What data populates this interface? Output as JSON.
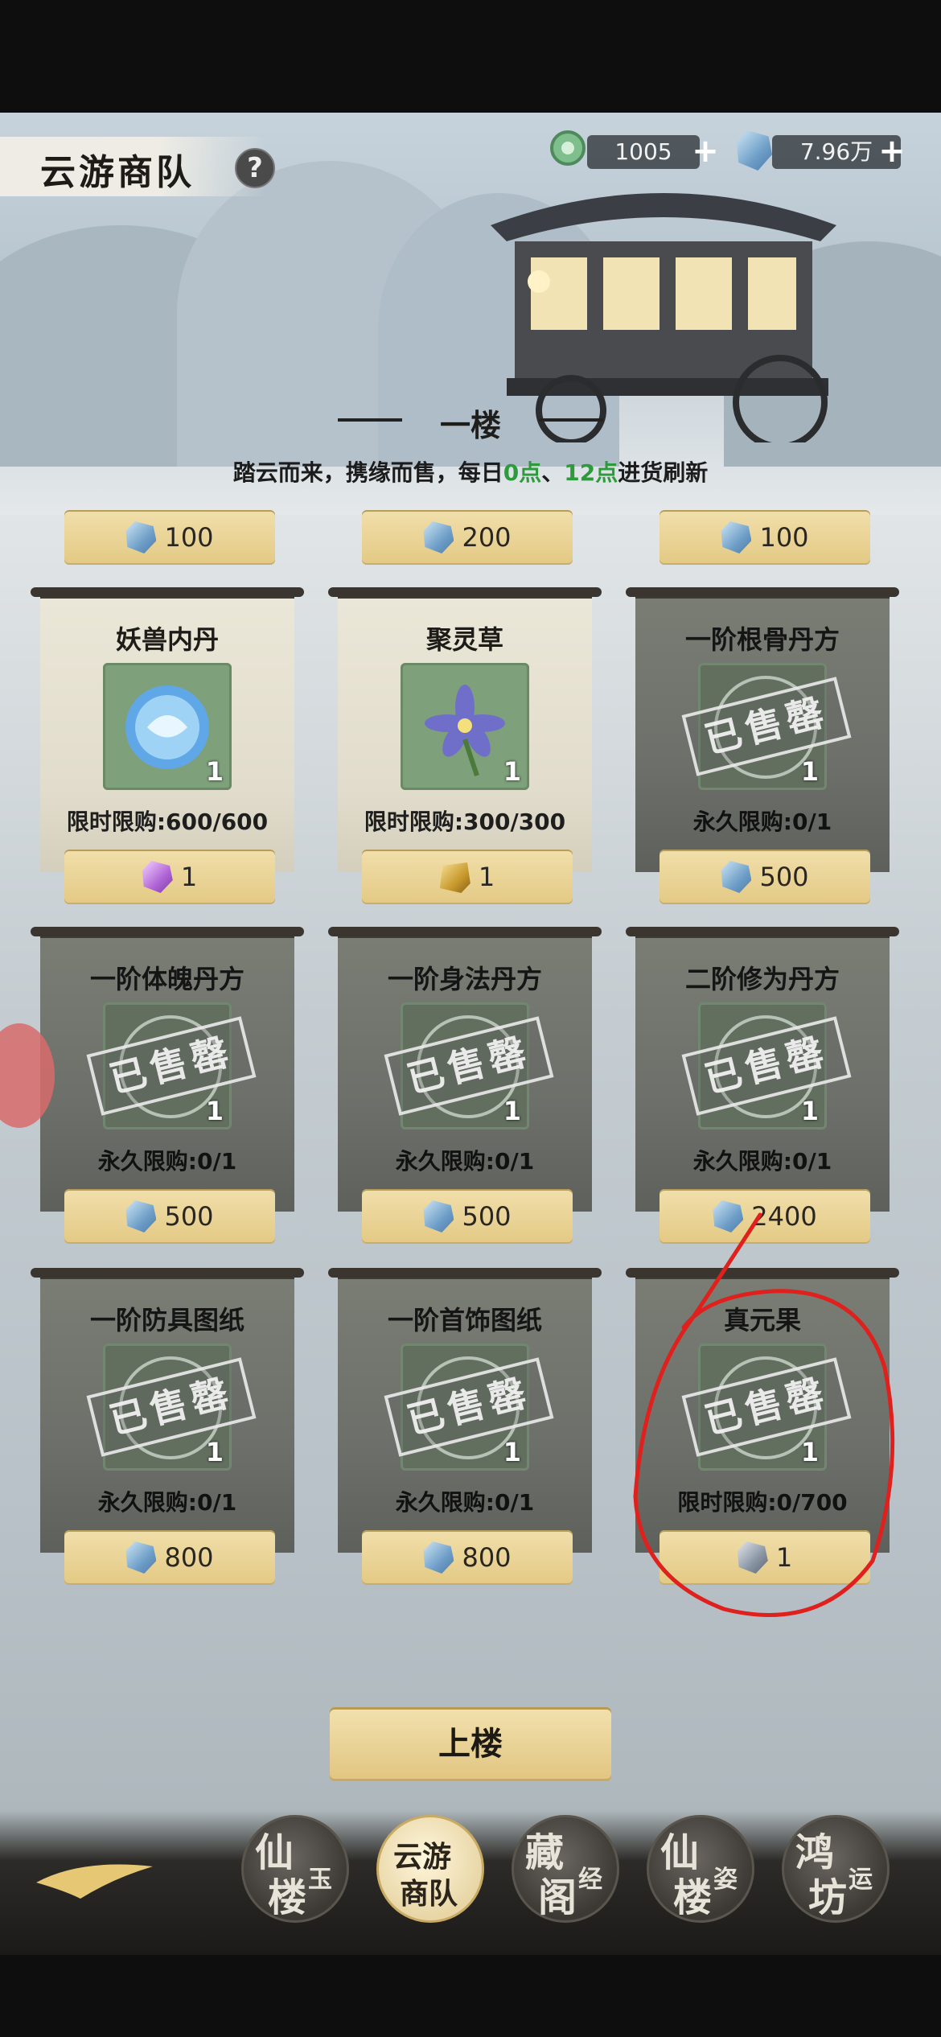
{
  "header": {
    "title": "云游商队",
    "help_label": "?",
    "currency": [
      {
        "icon": "jade-token-icon",
        "value": "1005",
        "plus": "+"
      },
      {
        "icon": "spirit-stone-icon",
        "value": "7.96万",
        "plus": "+"
      }
    ]
  },
  "floor": {
    "title": "一楼",
    "subtitle_pre": "踏云而来，携缘而售，每日",
    "subtitle_t1": "0点",
    "subtitle_sep": "、",
    "subtitle_t2": "12点",
    "subtitle_post": "进货刷新"
  },
  "top_prices": [
    "100",
    "200",
    "100"
  ],
  "cards": [
    {
      "name": "妖兽内丹",
      "count": "1",
      "limit": "限时限购:600/600",
      "price": "1",
      "currency_icon": "purple-crystal-icon",
      "sold_out": false
    },
    {
      "name": "聚灵草",
      "count": "1",
      "limit": "限时限购:300/300",
      "price": "1",
      "currency_icon": "gold-ingot-icon",
      "sold_out": false
    },
    {
      "name": "一阶根骨丹方",
      "count": "1",
      "limit": "永久限购:0/1",
      "price": "500",
      "currency_icon": "spirit-stone-icon",
      "sold_out": true
    },
    {
      "name": "一阶体魄丹方",
      "count": "1",
      "limit": "永久限购:0/1",
      "price": "500",
      "currency_icon": "spirit-stone-icon",
      "sold_out": true
    },
    {
      "name": "一阶身法丹方",
      "count": "1",
      "limit": "永久限购:0/1",
      "price": "500",
      "currency_icon": "spirit-stone-icon",
      "sold_out": true
    },
    {
      "name": "二阶修为丹方",
      "count": "1",
      "limit": "永久限购:0/1",
      "price": "2400",
      "currency_icon": "spirit-stone-icon",
      "sold_out": true
    },
    {
      "name": "一阶防具图纸",
      "count": "1",
      "limit": "永久限购:0/1",
      "price": "800",
      "currency_icon": "spirit-stone-icon",
      "sold_out": true
    },
    {
      "name": "一阶首饰图纸",
      "count": "1",
      "limit": "永久限购:0/1",
      "price": "800",
      "currency_icon": "spirit-stone-icon",
      "sold_out": true
    },
    {
      "name": "真元果",
      "count": "1",
      "limit": "限时限购:0/700",
      "price": "1",
      "currency_icon": "silver-ore-icon",
      "sold_out": true
    }
  ],
  "sold_stamp": "已售罄",
  "upstairs_label": "上楼",
  "nav": [
    {
      "big": "仙",
      "big2": "楼",
      "small": "玉",
      "active": false
    },
    {
      "big": "云游",
      "big2": "商队",
      "small": "",
      "active": true
    },
    {
      "big": "藏",
      "big2": "阁",
      "small": "经",
      "active": false
    },
    {
      "big": "仙",
      "big2": "楼",
      "small": "姿",
      "active": false
    },
    {
      "big": "鸿",
      "big2": "坊",
      "small": "运",
      "active": false
    }
  ],
  "colors": {
    "accent_green": "#2e9a3c",
    "annotation_red": "#e0201c",
    "gold_button": "#e8cf8d"
  }
}
